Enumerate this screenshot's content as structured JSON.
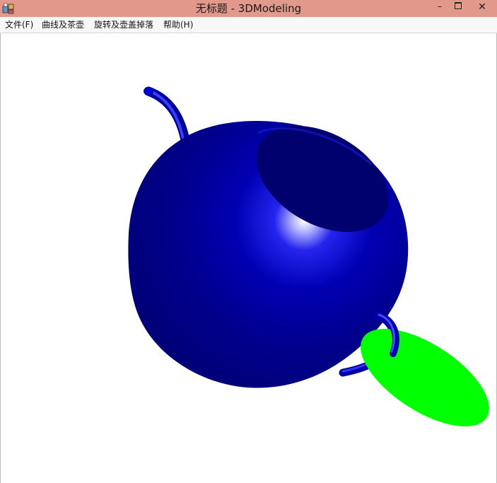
{
  "window": {
    "title": "无标题 - 3DModeling",
    "icon": "3dmodeling-app-icon",
    "controls": {
      "minimize": "–",
      "maximize": "maximize-icon",
      "close": "✕"
    }
  },
  "menu": {
    "items": [
      {
        "label": "文件(F)"
      },
      {
        "label": "曲线及茶壶"
      },
      {
        "label": "旋转及壶盖掉落"
      },
      {
        "label": "帮助(H)"
      }
    ]
  },
  "scene": {
    "teapot_color": "#0000b4",
    "teapot_shadow_color": "#00006a",
    "lid_color": "#00ff00",
    "background": "#ffffff"
  }
}
